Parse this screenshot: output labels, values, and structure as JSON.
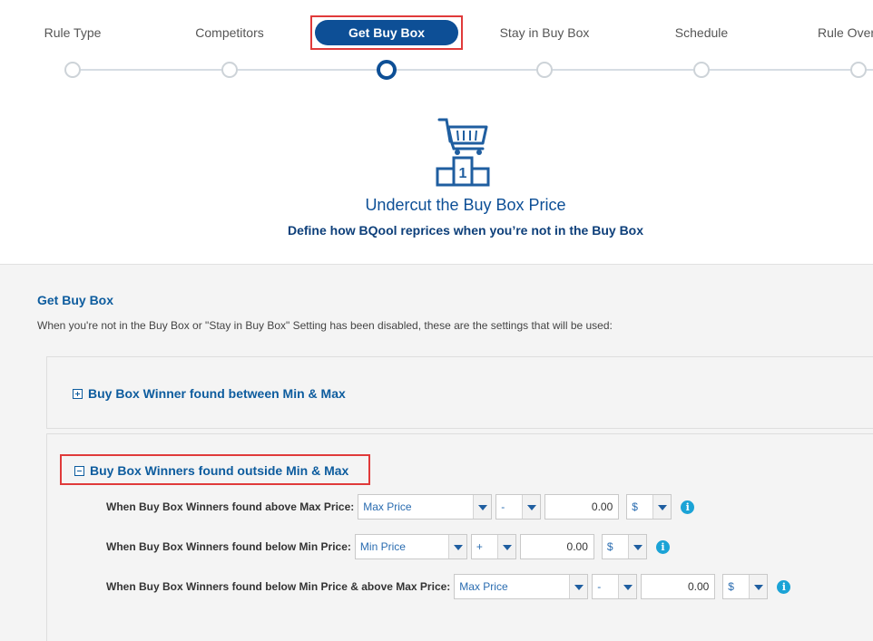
{
  "stepper": {
    "steps": [
      {
        "label": "Rule Type"
      },
      {
        "label": "Competitors"
      },
      {
        "label": "Get Buy Box"
      },
      {
        "label": "Stay in Buy Box"
      },
      {
        "label": "Schedule"
      },
      {
        "label": "Rule Over"
      }
    ],
    "active_index": 2
  },
  "hero": {
    "icon": "cart-podium-icon",
    "podium_number": "1",
    "title": "Undercut the Buy Box Price",
    "subtitle": "Define how BQool reprices when you’re not in the Buy Box"
  },
  "section": {
    "title": "Get Buy Box",
    "description": "When you're not in the Buy Box or \"Stay in Buy Box\" Setting has been disabled, these are the settings that will be used:"
  },
  "panels": [
    {
      "title": "Buy Box Winner found between Min & Max",
      "expanded": false
    },
    {
      "title": "Buy Box Winners found outside Min & Max",
      "expanded": true
    }
  ],
  "rows": [
    {
      "label": "When Buy Box Winners found above Max Price:",
      "base": "Max Price",
      "operator": "-",
      "amount": "0.00",
      "unit": "$"
    },
    {
      "label": "When Buy Box Winners found below Min Price:",
      "base": "Min Price",
      "operator": "+",
      "amount": "0.00",
      "unit": "$"
    },
    {
      "label": "When Buy Box Winners found below Min Price & above Max Price:",
      "base": "Max Price",
      "operator": "-",
      "amount": "0.00",
      "unit": "$"
    }
  ],
  "info_glyph": "i",
  "colors": {
    "accent": "#0d4f96",
    "link": "#0d5c9e",
    "highlight": "#e03a3a",
    "info": "#1ba3d6"
  }
}
